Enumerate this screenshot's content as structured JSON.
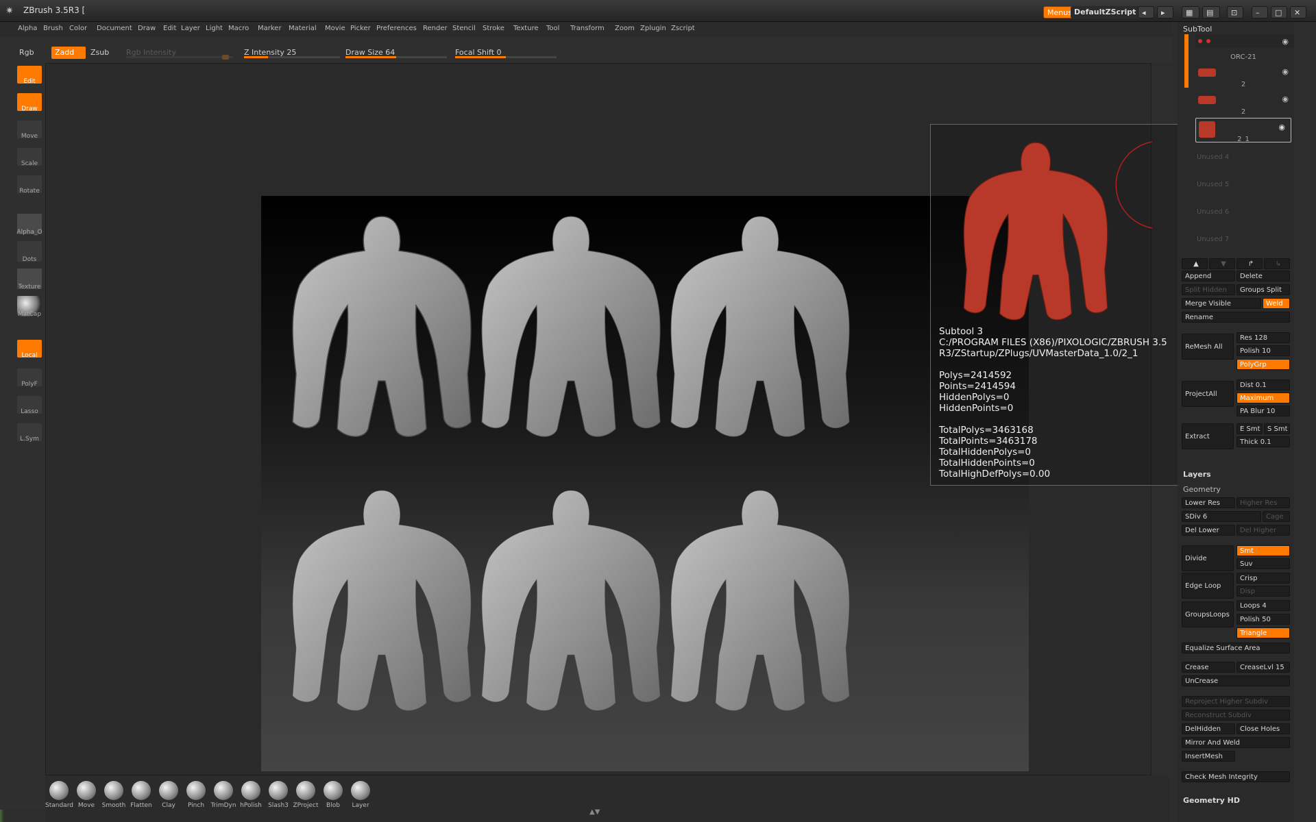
{
  "titlebar": {
    "title": "ZBrush 3.5R3 [",
    "menus_label": "Menus",
    "script_label": "DefaultZScript"
  },
  "menubar": [
    "Alpha",
    "Brush",
    "Color",
    "Document",
    "Draw",
    "Edit",
    "Layer",
    "Light",
    "Macro",
    "Marker",
    "Material",
    "Movie",
    "Picker",
    "Preferences",
    "Render",
    "Stencil",
    "Stroke",
    "Texture",
    "Tool",
    "Transform",
    "Zoom",
    "Zplugin",
    "Zscript"
  ],
  "ctrlbar": {
    "rgb": "Rgb",
    "zadd": "Zadd",
    "zsub": "Zsub",
    "rgb_intensity": "Rgb Intensity",
    "z_intensity": "Z Intensity 25",
    "draw_size": "Draw Size 64",
    "focal_shift": "Focal Shift 0",
    "z_intensity_value": 0.25,
    "draw_size_value": 0.5,
    "focal_shift_value": 0.5
  },
  "leftbar": [
    {
      "label": "Edit",
      "active": true
    },
    {
      "label": "Draw",
      "active": true
    },
    {
      "label": "Move",
      "active": false
    },
    {
      "label": "Scale",
      "active": false
    },
    {
      "label": "Rotate",
      "active": false
    },
    {
      "label": "Alpha_O",
      "active": false
    },
    {
      "label": "Dots",
      "active": false
    },
    {
      "label": "Texture",
      "active": false
    },
    {
      "label": "MatCap",
      "active": false
    },
    {
      "label": "Local",
      "active": true
    },
    {
      "label": "PolyF",
      "active": false
    },
    {
      "label": "Lasso",
      "active": false
    },
    {
      "label": "L.Sym",
      "active": false
    }
  ],
  "info": {
    "lines": [
      "Subtool 3",
      "C:/PROGRAM FILES (X86)/PIXOLOGIC/ZBRUSH 3.5",
      "R3/ZStartup/ZPlugs/UVMasterData_1.0/2_1",
      "",
      "Polys=2414592",
      "Points=2414594",
      "HiddenPolys=0",
      "HiddenPoints=0",
      "",
      "TotalPolys=3463168",
      "TotalPoints=3463178",
      "TotalHiddenPolys=0",
      "TotalHiddenPoints=0",
      "TotalHighDefPolys=0.00"
    ]
  },
  "subtool": {
    "title": "SubTool",
    "items": [
      "ORC-21",
      "2",
      "2",
      "2_1"
    ],
    "unused": [
      "Unused 4",
      "Unused 5",
      "Unused 6",
      "Unused 7"
    ],
    "append": "Append",
    "delete": "Delete",
    "split_hidden": "Split Hidden",
    "groups_split": "Groups Split",
    "merge_visible": "Merge Visible",
    "weld": "Weld",
    "rename": "Rename",
    "remesh_all": "ReMesh All",
    "res": "Res 128",
    "polish": "Polish 10",
    "polygrp": "PolyGrp",
    "project_all": "ProjectAll",
    "dist": "Dist 0.1",
    "maximum": "Maximum",
    "pa_blur": "PA Blur 10",
    "extract": "Extract",
    "e_smt": "E Smt",
    "s_smt": "S Smt",
    "thick": "Thick 0.1"
  },
  "layers_title": "Layers",
  "geometry": {
    "title": "Geometry",
    "lower_res": "Lower Res",
    "higher_res": "Higher Res",
    "sdiv": "SDiv 6",
    "cage": "Cage",
    "del_lower": "Del Lower",
    "del_higher": "Del Higher",
    "divide": "Divide",
    "smt": "Smt",
    "suv": "Suv",
    "crisp": "Crisp",
    "disp": "Disp",
    "edge_loop": "Edge Loop",
    "loops": "Loops 4",
    "polish50": "Polish 50",
    "groups_loops": "GroupsLoops",
    "triangle": "Triangle",
    "equalize": "Equalize Surface Area",
    "crease": "Crease",
    "crease_lvl": "CreaseLvl 15",
    "uncrease": "UnCrease",
    "reproject": "Reproject Higher Subdiv",
    "reconstruct": "Reconstruct Subdiv",
    "del_hidden": "DelHidden",
    "close_holes": "Close Holes",
    "mirror_weld": "Mirror And Weld",
    "insert_mesh": "InsertMesh",
    "check_mesh": "Check Mesh Integrity"
  },
  "geometry_hd": "Geometry HD",
  "brushes": [
    "Standard",
    "Move",
    "Smooth",
    "Flatten",
    "Clay",
    "Pinch",
    "TrimDyn",
    "hPolish",
    "Slash3",
    "ZProject",
    "Blob",
    "Layer"
  ],
  "colors": {
    "accent": "#ff7a00",
    "model_red": "#b8382a",
    "model_grey": "#9a9a9a"
  }
}
